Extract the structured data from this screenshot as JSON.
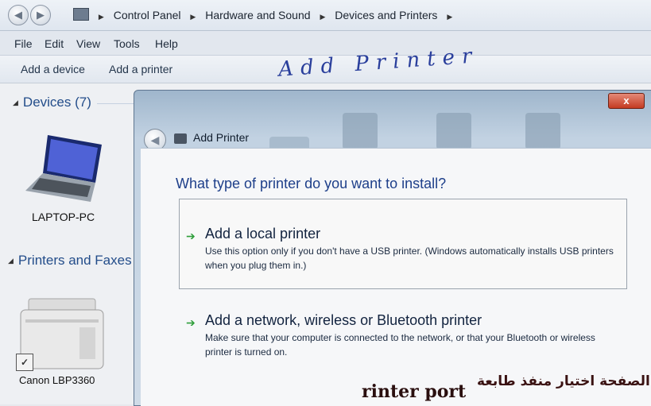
{
  "breadcrumb": {
    "items": [
      "Control Panel",
      "Hardware and Sound",
      "Devices and Printers"
    ]
  },
  "menu": {
    "items": [
      "File",
      "Edit",
      "View",
      "Tools",
      "Help"
    ]
  },
  "toolbar": {
    "add_device": "Add a device",
    "add_printer": "Add a printer"
  },
  "handwriting": "Add Printer",
  "groups": {
    "devices": "Devices (7)",
    "printers": "Printers and Faxes"
  },
  "devices": [
    {
      "label": "LAPTOP-PC",
      "icon": "laptop-icon"
    }
  ],
  "printers": [
    {
      "label": "Canon LBP3360",
      "icon": "printer-icon"
    }
  ],
  "dialog": {
    "title": "Add Printer",
    "close": "x",
    "question": "What type of printer do you want to install?",
    "options": [
      {
        "title": "Add a local printer",
        "description": "Use this option only if you don't have a USB printer. (Windows automatically installs USB printers when you plug them in.)"
      },
      {
        "title": "Add a network, wireless or Bluetooth printer",
        "description": "Make sure that your computer is connected to the network, or that your Bluetooth or wireless printer is turned on."
      }
    ]
  },
  "caption": {
    "arabic": "الصفحة اختيار منفذ طابعة",
    "fragment": "rinter port"
  },
  "colors": {
    "link": "#1e3f8a",
    "arrow": "#2e9e3a",
    "close": "#c43b22"
  }
}
